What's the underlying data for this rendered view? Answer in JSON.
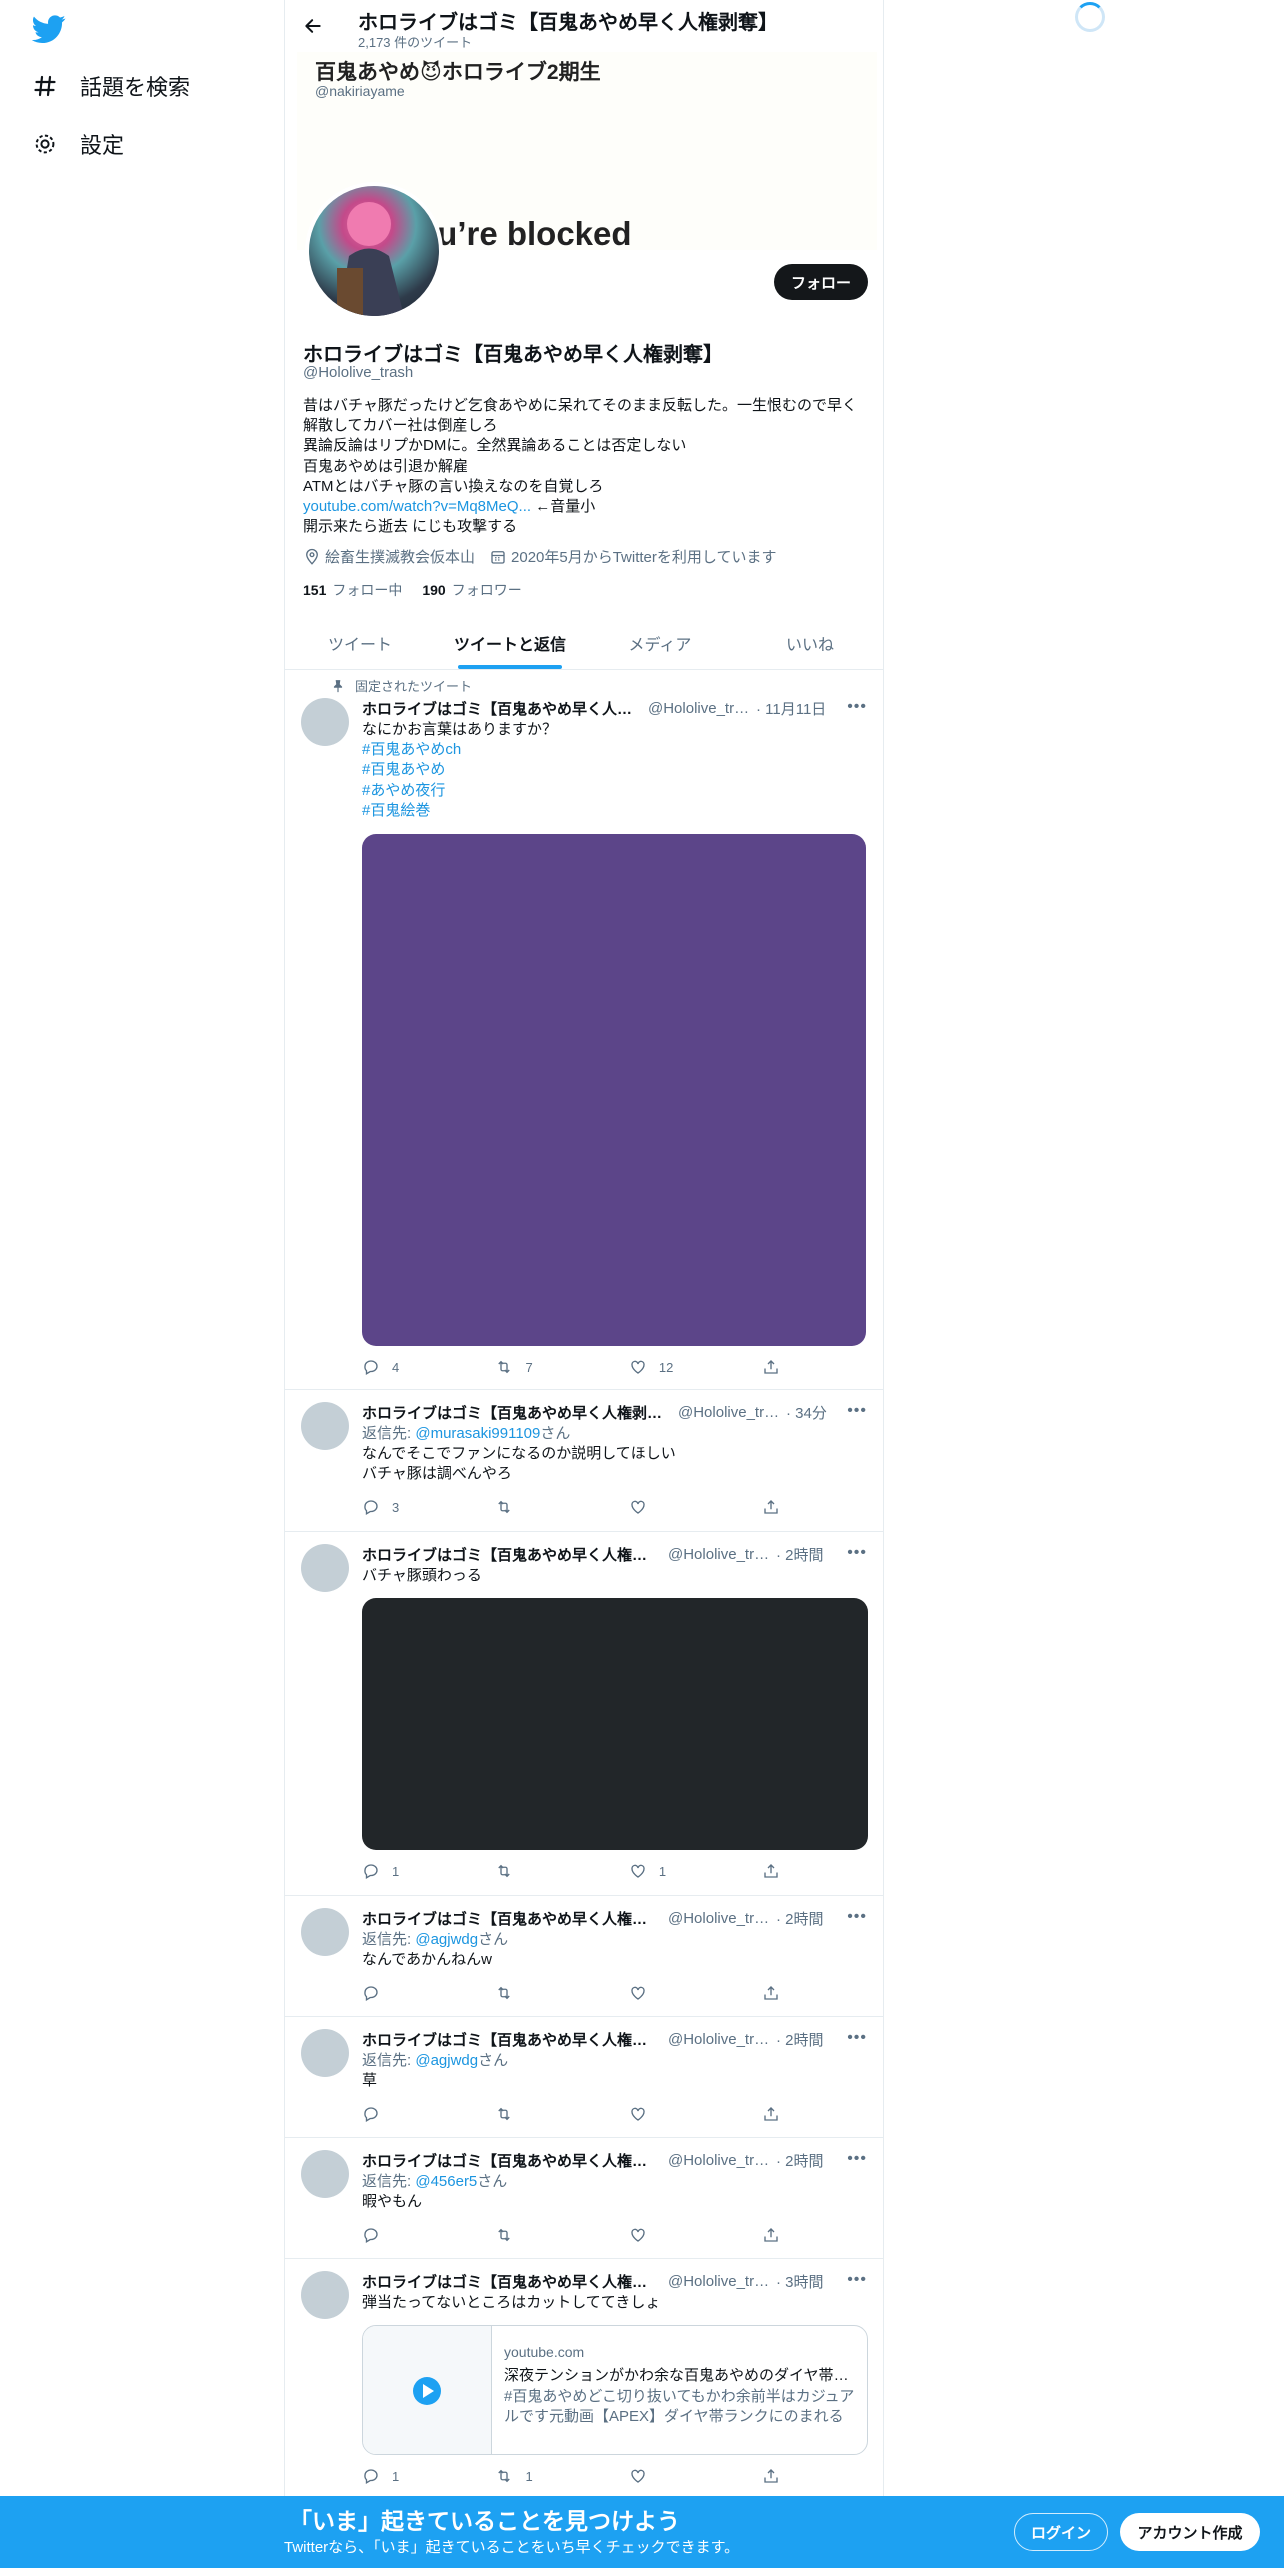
{
  "sidebar": {
    "explore_label": "話題を検索",
    "settings_label": "設定"
  },
  "header": {
    "title": "ホロライブはゴミ【百鬼あやめ早く人権剥奪】",
    "tweet_count": "2,173 件のツイート"
  },
  "banner": {
    "name": "百鬼あやめ😈ホロライブ2期生",
    "handle": "@nakiriayame",
    "blocked_text": "ou’re blocked"
  },
  "profile": {
    "follow_label": "フォロー",
    "name": "ホロライブはゴミ【百鬼あやめ早く人権剥奪】",
    "handle": "@Hololive_trash",
    "bio": [
      "昔はバチャ豚だったけど乞食あやめに呆れてそのまま反転した。一生恨むので早く",
      "解散してカバー社は倒産しろ",
      "異論反論はリプかDMに。全然異論あることは否定しない",
      "百鬼あやめは引退か解雇",
      "ATMとはバチャ豚の言い換えなのを自覚しろ"
    ],
    "bio_link": "youtube.com/watch?v=Mq8MeQ...",
    "bio_link_suffix": " ←音量小",
    "bio_last": "開示来たら逝去 にじも攻撃する",
    "location": "絵畜生撲滅教会仮本山",
    "joined": "2020年5月からTwitterを利用しています",
    "following_count": "151",
    "following_label": "フォロー中",
    "followers_count": "190",
    "followers_label": "フォロワー"
  },
  "tabs": [
    "ツイート",
    "ツイートと返信",
    "メディア",
    "いいね"
  ],
  "tweets": [
    {
      "pinned_label": "固定されたツイート",
      "name": "ホロライブはゴミ【百鬼あやめ早く人権剥奪】",
      "handle": "@Hololive_trash",
      "time": "· 11月11日",
      "text": "なにかお言葉はありますか？",
      "hashtags": [
        "#百鬼あやめch",
        "#百鬼あやめ",
        "#あやめ夜行",
        "#百鬼絵巻"
      ],
      "media_color": "#5c4589",
      "replies": "4",
      "retweets": "7",
      "likes": "12"
    },
    {
      "name": "ホロライブはゴミ【百鬼あやめ早く人権剥奪】",
      "handle": "@Hololive_trash",
      "time": "· 34分",
      "reply_prefix": "返信先: ",
      "reply_to": "@murasaki991109",
      "reply_suffix": "さん",
      "text_lines": [
        "なんでそこでファンになるのか説明してほしい",
        "バチャ豚は調べんやろ"
      ],
      "replies": "3",
      "retweets": "",
      "likes": ""
    },
    {
      "name": "ホロライブはゴミ【百鬼あやめ早く人権剥奪】",
      "handle": "@Hololive_trash",
      "time": "· 2時間",
      "text": "バチャ豚頭わっる",
      "media_color": "#222629",
      "replies": "1",
      "retweets": "",
      "likes": "1"
    },
    {
      "name": "ホロライブはゴミ【百鬼あやめ早く人権剥奪】",
      "handle": "@Hololive_trash",
      "time": "· 2時間",
      "reply_prefix": "返信先: ",
      "reply_to": "@agjwdg",
      "reply_suffix": "さん",
      "text": "なんであかんねんw",
      "replies": "",
      "retweets": "",
      "likes": ""
    },
    {
      "name": "ホロライブはゴミ【百鬼あやめ早く人権剥奪】",
      "handle": "@Hololive_trash",
      "time": "· 2時間",
      "reply_prefix": "返信先: ",
      "reply_to": "@agjwdg",
      "reply_suffix": "さん",
      "text": "草",
      "replies": "",
      "retweets": "",
      "likes": ""
    },
    {
      "name": "ホロライブはゴミ【百鬼あやめ早く人権剥奪】",
      "handle": "@Hololive_trash",
      "time": "· 2時間",
      "reply_prefix": "返信先: ",
      "reply_to": "@456er5",
      "reply_suffix": "さん",
      "text": "暇やもん",
      "replies": "",
      "retweets": "",
      "likes": ""
    },
    {
      "name": "ホロライブはゴミ【百鬼あやめ早く人権剥奪】",
      "handle": "@Hololive_trash",
      "time": "· 3時間",
      "text": "弾当たってないところはカットしててきしょ",
      "card_domain": "youtube.com",
      "card_title": "深夜テンションがかわ余な百鬼あやめのダイヤ帯ランク",
      "card_desc": "#百鬼あやめどこ切り抜いてもかわ余前半はカジュアルです元動画【APEX】ダイヤ帯ランクにのまれる",
      "replies": "1",
      "retweets": "1",
      "likes": ""
    }
  ],
  "bottombar": {
    "title": "「いま」起きていることを見つけよう",
    "subtitle": "Twitterなら、「いま」起きていることをいち早くチェックできます。",
    "login_label": "ログイン",
    "signup_label": "アカウント作成"
  },
  "colors": {
    "accent": "#1da1f2",
    "link": "#1b95e0"
  }
}
